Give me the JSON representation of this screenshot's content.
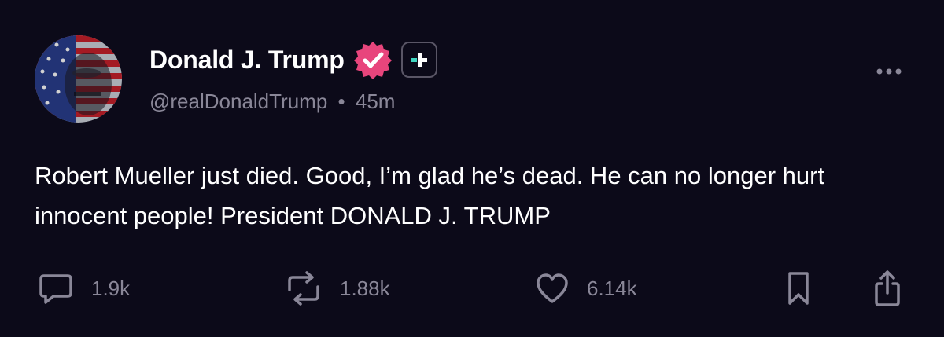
{
  "post": {
    "author": {
      "display_name": "Donald J. Trump",
      "handle": "@realDonaldTrump",
      "verified_icon": "verified-badge-icon",
      "verified_color": "#e8457c"
    },
    "separator": "•",
    "timestamp": "45m",
    "text": "Robert Mueller just died. Good, I’m glad he’s dead. He can no longer hurt innocent people! President DONALD J. TRUMP",
    "actions": {
      "replies": "1.9k",
      "reposts": "1.88k",
      "likes": "6.14k"
    }
  },
  "colors": {
    "background": "#0c0a19",
    "text": "#ffffff",
    "muted": "#8a8798",
    "accent_teal": "#3fd4c0"
  }
}
